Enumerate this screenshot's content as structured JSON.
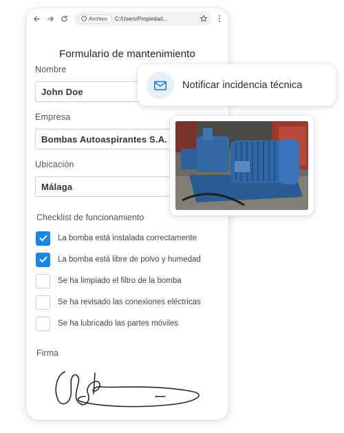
{
  "browser": {
    "back": "←",
    "forward": "→",
    "reload": "↻",
    "chip_label": "Archivo",
    "url": "C:/Users/Propiedad..."
  },
  "form": {
    "title": "Formulario de mantenimiento",
    "fields": [
      {
        "label": "Nombre",
        "value": "John Doe"
      },
      {
        "label": "Empresa",
        "value": "Bombas Autoaspirantes S.A."
      },
      {
        "label": "Ubicación",
        "value": "Málaga"
      }
    ],
    "checklist_title": "Checklist de funcionamiento",
    "checklist": [
      {
        "label": "La bomba está instalada correctamente",
        "checked": true
      },
      {
        "label": "La bomba está libre de polvo y humedad",
        "checked": true
      },
      {
        "label": "Se ha limpiado el filtro de la bomba",
        "checked": false
      },
      {
        "label": "Se ha revisado las conexiones eléctricas",
        "checked": false
      },
      {
        "label": "Se ha lubricado las partes móviles",
        "checked": false
      }
    ],
    "signature_label": "Firma"
  },
  "notification": {
    "label": "Notificar incidencia técnica",
    "icon": "mail-icon"
  },
  "colors": {
    "accent": "#1a85e8",
    "mail_bg": "#e5f0fb",
    "mail_stroke": "#1a6fd1",
    "pump_blue": "#2f66a8"
  }
}
